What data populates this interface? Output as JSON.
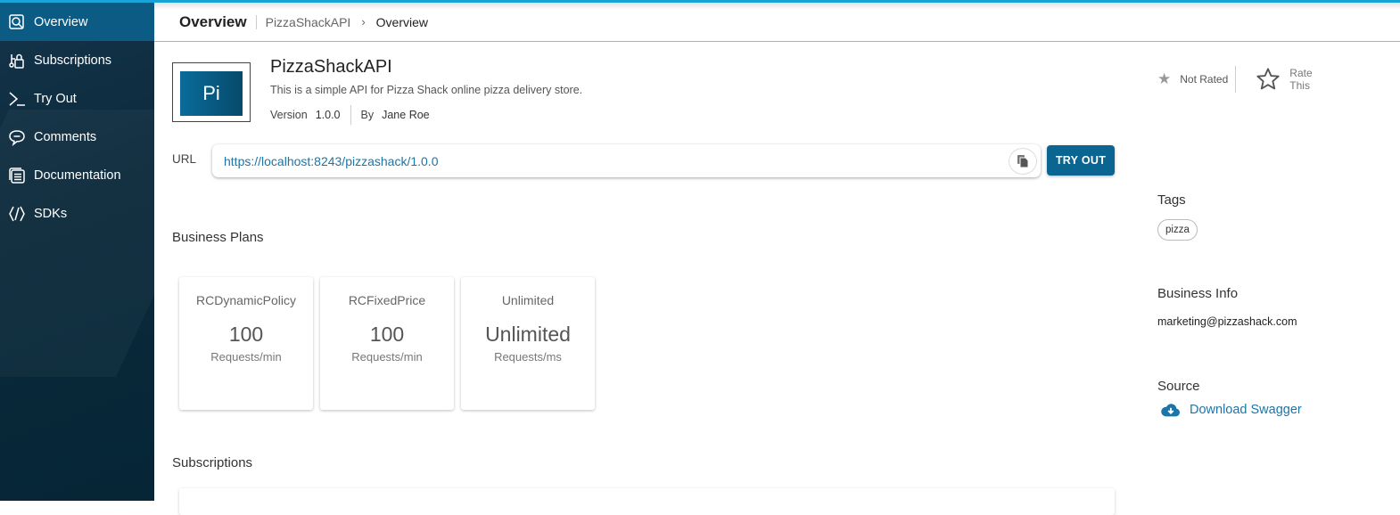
{
  "colors": {
    "accent_bar": "#1aa3d6",
    "sidebar_active": "#0c5b84",
    "link": "#1d74a6",
    "primary_button": "#0a6591"
  },
  "sidebar": {
    "items": [
      {
        "label": "Overview",
        "icon": "overview-search-icon",
        "active": true
      },
      {
        "label": "Subscriptions",
        "icon": "subscriptions-icon",
        "active": false
      },
      {
        "label": "Try Out",
        "icon": "terminal-icon",
        "active": false
      },
      {
        "label": "Comments",
        "icon": "comment-icon",
        "active": false
      },
      {
        "label": "Documentation",
        "icon": "documentation-icon",
        "active": false
      },
      {
        "label": "SDKs",
        "icon": "code-icon",
        "active": false
      }
    ]
  },
  "header": {
    "title": "Overview",
    "breadcrumb": [
      "PizzaShackAPI",
      "Overview"
    ]
  },
  "api": {
    "logo_text": "Pi",
    "name": "PizzaShackAPI",
    "description": "This is a simple API for Pizza Shack online pizza delivery store.",
    "version_label": "Version",
    "version": "1.0.0",
    "by_label": "By",
    "author": "Jane Roe"
  },
  "rating": {
    "status": "Not Rated",
    "rate_label_line1": "Rate",
    "rate_label_line2": "This"
  },
  "url": {
    "label": "URL",
    "value": "https://localhost:8243/pizzashack/1.0.0",
    "try_out_label": "TRY OUT"
  },
  "business_plans": {
    "title": "Business Plans",
    "plans": [
      {
        "name": "RCDynamicPolicy",
        "value": "100",
        "unit": "Requests/min"
      },
      {
        "name": "RCFixedPrice",
        "value": "100",
        "unit": "Requests/min"
      },
      {
        "name": "Unlimited",
        "value": "Unlimited",
        "unit": "Requests/ms"
      }
    ]
  },
  "subscriptions": {
    "title": "Subscriptions"
  },
  "tags": {
    "title": "Tags",
    "items": [
      "pizza"
    ]
  },
  "business_info": {
    "title": "Business Info",
    "email": "marketing@pizzashack.com"
  },
  "source": {
    "title": "Source",
    "download_label": "Download Swagger"
  }
}
